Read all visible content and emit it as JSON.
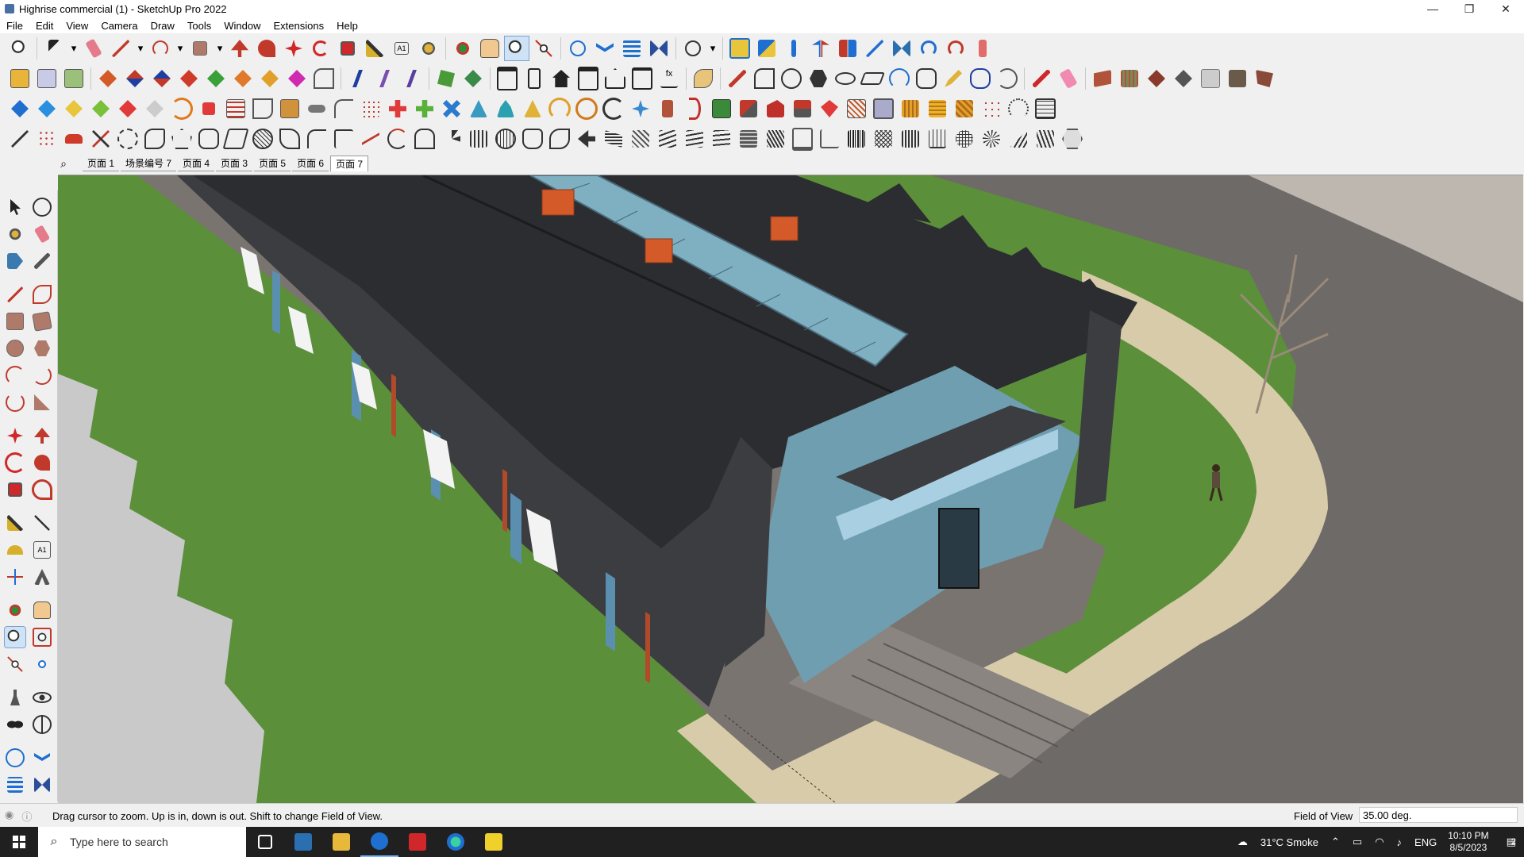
{
  "window": {
    "title": "Highrise commercial (1) - SketchUp Pro 2022",
    "minimize": "—",
    "restore": "❐",
    "close": "✕"
  },
  "menu": [
    "File",
    "Edit",
    "View",
    "Camera",
    "Draw",
    "Tools",
    "Window",
    "Extensions",
    "Help"
  ],
  "scenes": {
    "tabs": [
      "页面 1",
      "场景编号 7",
      "页面 4",
      "页面 3",
      "页面 5",
      "页面 6",
      "页面 7"
    ],
    "selected": "页面 7"
  },
  "status": {
    "message": "Drag cursor to zoom.  Up is in, down is out. Shift to change Field of View.",
    "fov_label": "Field of View",
    "fov_value": "35.00 deg."
  },
  "taskbar": {
    "search_placeholder": "Type here to search",
    "weather": "31°C  Smoke",
    "language": "ENG",
    "time": "10:10 PM",
    "date": "8/5/2023",
    "notifications": "2"
  },
  "colors": {
    "roof": "#2b2d30",
    "grass": "#5b8f3a",
    "paving": "#d8cba9",
    "road": "#6e6a67",
    "glass": "#7fb0c2",
    "accent_orange": "#d45a2a",
    "accent_blue": "#1f6fd1"
  }
}
